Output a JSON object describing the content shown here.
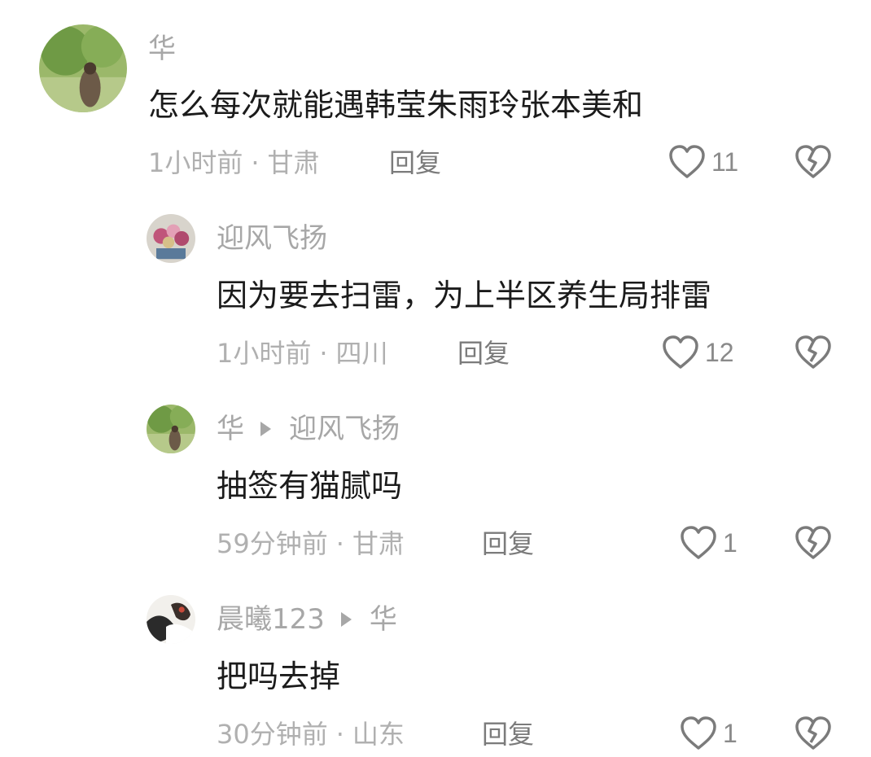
{
  "comments": [
    {
      "author": "华",
      "text": "怎么每次就能遇韩莹朱雨玲张本美和",
      "time": "1小时前",
      "location": "甘肃",
      "reply_label": "回复",
      "likes": "11"
    },
    {
      "author": "迎风飞扬",
      "text": "因为要去扫雷，为上半区养生局排雷",
      "time": "1小时前",
      "location": "四川",
      "reply_label": "回复",
      "likes": "12"
    },
    {
      "author": "华",
      "reply_to": "迎风飞扬",
      "text": "抽签有猫腻吗",
      "time": "59分钟前",
      "location": "甘肃",
      "reply_label": "回复",
      "likes": "1"
    },
    {
      "author": "晨曦123",
      "reply_to": "华",
      "text": "把吗去掉",
      "time": "30分钟前",
      "location": "山东",
      "reply_label": "回复",
      "likes": "1"
    }
  ],
  "meta_separator": "·",
  "colors": {
    "text": "#1b1b1b",
    "muted": "#a7a7a7",
    "icon": "#7b7b7b"
  }
}
